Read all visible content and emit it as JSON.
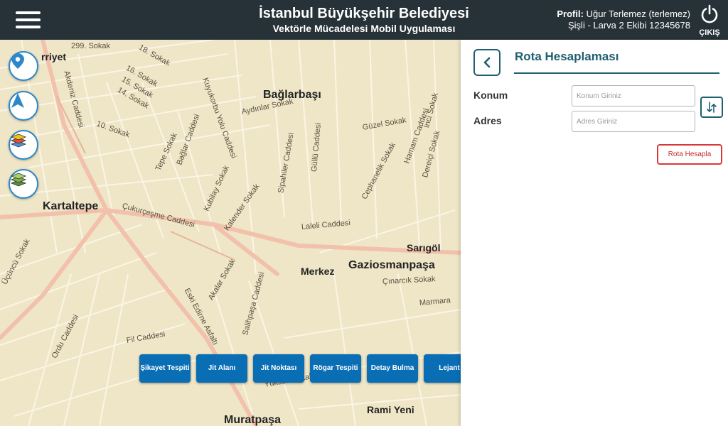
{
  "header": {
    "title": "İstanbul Büyükşehir Belediyesi",
    "subtitle": "Vektörle Mücadelesi Mobil Uygulaması",
    "profile_label": "Profil:",
    "profile_name": "Uğur Terlemez (terlemez)",
    "team_info": "Şişli - Larva 2 Ekibi 12345678",
    "logout_label": "ÇIKIŞ"
  },
  "map": {
    "places": [
      "Bağlarbaşı",
      "Kartaltepe",
      "Merkez",
      "Gaziosmanpaşa",
      "Sarıgöl",
      "Rami Yeni",
      "Muratpaşa",
      "rriyet"
    ],
    "streets": [
      "299. Sokak",
      "18. Sokak",
      "16. Sokak",
      "15. Sokak",
      "14. Sokak",
      "10. Sokak",
      "Akdeniz Caddesi",
      "Çukurçeşme Caddesi",
      "Laleli Caddesi",
      "Eski Edirne Asfaltı",
      "Sipahiler Caddesi",
      "Kubilay Sokak",
      "Kalender Sokak",
      "Akalar Sokak",
      "Salihpaşa Caddesi",
      "Çınarcık Sokak",
      "Marmara",
      "Yüksek Sokak",
      "Fil Caddesi",
      "Ordu Caddesi",
      "Güzel Sokak",
      "Aydınlar Sokak",
      "Kuyukorbu Yolu Caddesi",
      "Tepe Sokak",
      "Bağlar Caddesi",
      "Güllü Caddesi",
      "Cephanelik Sokak",
      "İnci Sokak",
      "Hamam Caddesi",
      "Dereiçi Sokak",
      "Üçüncü Sokak"
    ],
    "tools": [
      "location-pin-icon",
      "navigation-arrow-icon",
      "layers-color-icon",
      "layers-green-icon"
    ]
  },
  "actions": [
    "Şikayet Tespiti",
    "Jit Alanı",
    "Jit Noktası",
    "Rögar Tespiti",
    "Detay Bulma",
    "Lejant"
  ],
  "panel": {
    "title": "Rota Hesaplaması",
    "konum_label": "Konum",
    "konum_placeholder": "Konum Giriniz",
    "konum_value": "",
    "adres_label": "Adres",
    "adres_placeholder": "Adres Giriniz",
    "adres_value": "",
    "calc_button": "Rota Hesapla"
  },
  "colors": {
    "header_bg": "#263238",
    "accent": "#1f5f6e",
    "action_blue": "#0a6eb4",
    "danger": "#d9383a",
    "map_bg": "#efe6c8",
    "major_road": "#f1b8a0"
  }
}
